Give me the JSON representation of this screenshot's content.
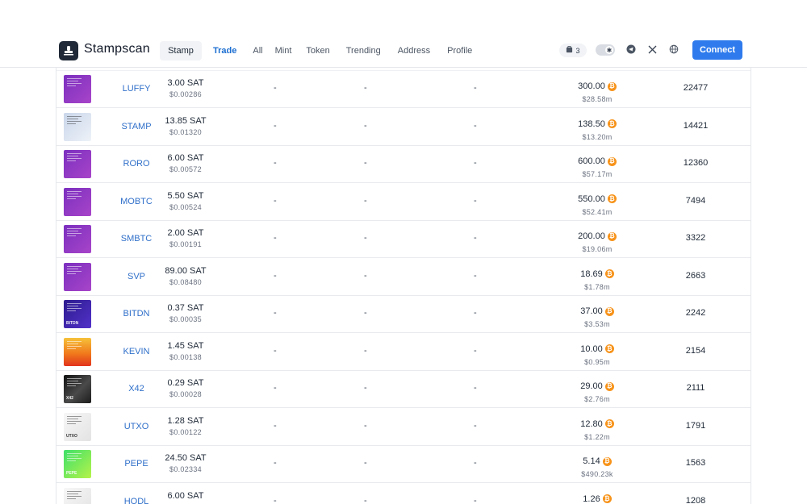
{
  "header": {
    "brand": "Stampscan",
    "nav": [
      {
        "label": "Stamp"
      },
      {
        "label": "Trade"
      },
      {
        "label": "All"
      },
      {
        "label": "Mint"
      },
      {
        "label": "Token"
      },
      {
        "label": "Trending"
      },
      {
        "label": "Address"
      },
      {
        "label": "Profile"
      }
    ],
    "cart_count": "3",
    "connect_label": "Connect"
  },
  "colors": {
    "accent": "#2f7bed",
    "link": "#2f6fc9",
    "btc": "#f7931a"
  },
  "rows": [
    {
      "name": "LUFFY",
      "price": "3.00 SAT",
      "price_usd": "$0.00286",
      "c1": "-",
      "c2": "-",
      "c3": "-",
      "mcap": "300.00",
      "mcap_usd": "$28.58m",
      "holders": "22477",
      "thumb": "purple"
    },
    {
      "name": "STAMP",
      "price": "13.85 SAT",
      "price_usd": "$0.01320",
      "c1": "-",
      "c2": "-",
      "c3": "-",
      "mcap": "138.50",
      "mcap_usd": "$13.20m",
      "holders": "14421",
      "thumb": "light"
    },
    {
      "name": "RORO",
      "price": "6.00 SAT",
      "price_usd": "$0.00572",
      "c1": "-",
      "c2": "-",
      "c3": "-",
      "mcap": "600.00",
      "mcap_usd": "$57.17m",
      "holders": "12360",
      "thumb": "purple"
    },
    {
      "name": "MOBTC",
      "price": "5.50 SAT",
      "price_usd": "$0.00524",
      "c1": "-",
      "c2": "-",
      "c3": "-",
      "mcap": "550.00",
      "mcap_usd": "$52.41m",
      "holders": "7494",
      "thumb": "purple"
    },
    {
      "name": "SMBTC",
      "price": "2.00 SAT",
      "price_usd": "$0.00191",
      "c1": "-",
      "c2": "-",
      "c3": "-",
      "mcap": "200.00",
      "mcap_usd": "$19.06m",
      "holders": "3322",
      "thumb": "purple"
    },
    {
      "name": "SVP",
      "price": "89.00 SAT",
      "price_usd": "$0.08480",
      "c1": "-",
      "c2": "-",
      "c3": "-",
      "mcap": "18.69",
      "mcap_usd": "$1.78m",
      "holders": "2663",
      "thumb": "purple"
    },
    {
      "name": "BITDN",
      "price": "0.37 SAT",
      "price_usd": "$0.00035",
      "c1": "-",
      "c2": "-",
      "c3": "-",
      "mcap": "37.00",
      "mcap_usd": "$3.53m",
      "holders": "2242",
      "thumb": "indigo",
      "thumb_text": "BITDN"
    },
    {
      "name": "KEVIN",
      "price": "1.45 SAT",
      "price_usd": "$0.00138",
      "c1": "-",
      "c2": "-",
      "c3": "-",
      "mcap": "10.00",
      "mcap_usd": "$0.95m",
      "holders": "2154",
      "thumb": "orange"
    },
    {
      "name": "X42",
      "price": "0.29 SAT",
      "price_usd": "$0.00028",
      "c1": "-",
      "c2": "-",
      "c3": "-",
      "mcap": "29.00",
      "mcap_usd": "$2.76m",
      "holders": "2111",
      "thumb": "dark",
      "thumb_text": "X42"
    },
    {
      "name": "UTXO",
      "price": "1.28 SAT",
      "price_usd": "$0.00122",
      "c1": "-",
      "c2": "-",
      "c3": "-",
      "mcap": "12.80",
      "mcap_usd": "$1.22m",
      "holders": "1791",
      "thumb": "white",
      "thumb_text": "UTXO"
    },
    {
      "name": "PEPE",
      "price": "24.50 SAT",
      "price_usd": "$0.02334",
      "c1": "-",
      "c2": "-",
      "c3": "-",
      "mcap": "5.14",
      "mcap_usd": "$490.23k",
      "holders": "1563",
      "thumb": "green",
      "thumb_text": "PEPE"
    },
    {
      "name": "HODL",
      "price": "6.00 SAT",
      "price_usd": "",
      "c1": "-",
      "c2": "-",
      "c3": "-",
      "mcap": "1.26",
      "mcap_usd": "",
      "holders": "1208",
      "thumb": "white"
    }
  ]
}
